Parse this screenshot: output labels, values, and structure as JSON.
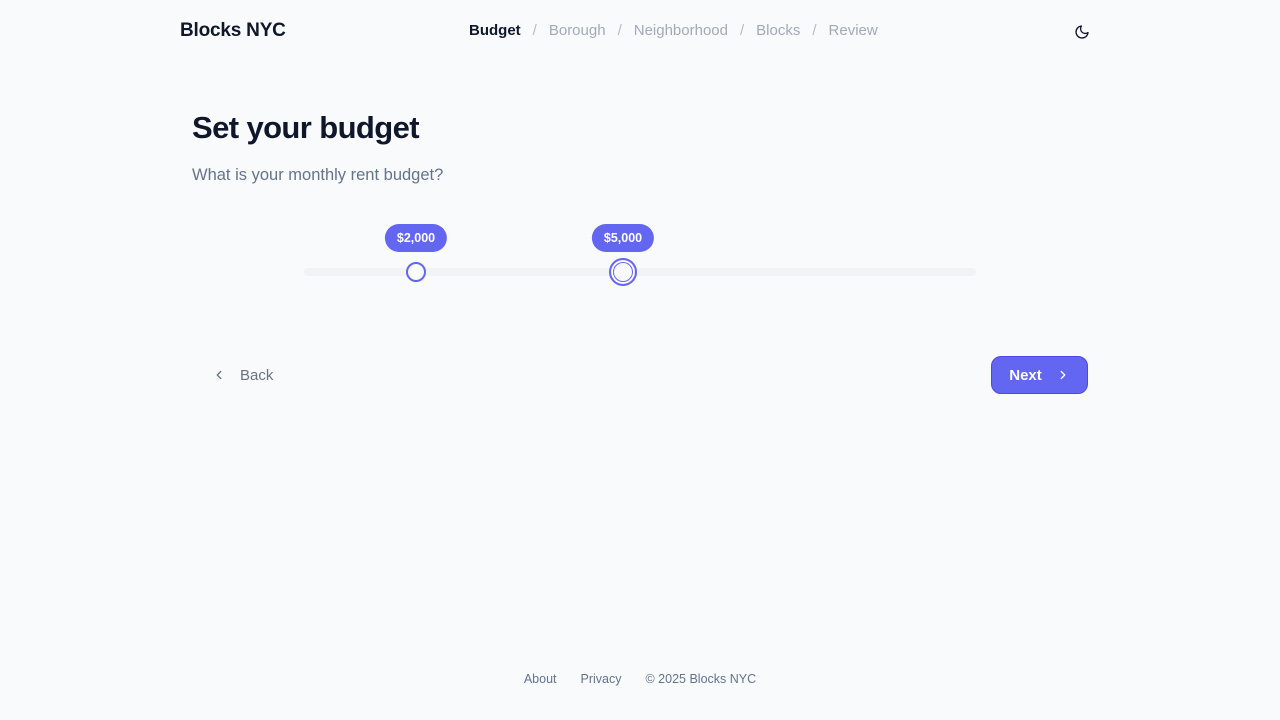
{
  "header": {
    "brand": "Blocks NYC",
    "steps": [
      "Budget",
      "Borough",
      "Neighborhood",
      "Blocks",
      "Review"
    ],
    "separator": "/",
    "active_step": "Budget",
    "theme_icon": "moon-icon"
  },
  "main": {
    "title": "Set your budget",
    "subtitle": "What is your monthly rent budget?"
  },
  "budget_slider": {
    "min_label": "$2,000",
    "max_label": "$5,000",
    "min_fraction": 0.167,
    "max_fraction": 0.474,
    "accent_color": "#6366f1"
  },
  "nav": {
    "back_label": "Back",
    "back_icon": "chevron-left-icon",
    "next_label": "Next",
    "next_icon": "chevron-right-icon"
  },
  "footer": {
    "about": "About",
    "privacy": "Privacy",
    "copyright": "© 2025 Blocks NYC"
  }
}
